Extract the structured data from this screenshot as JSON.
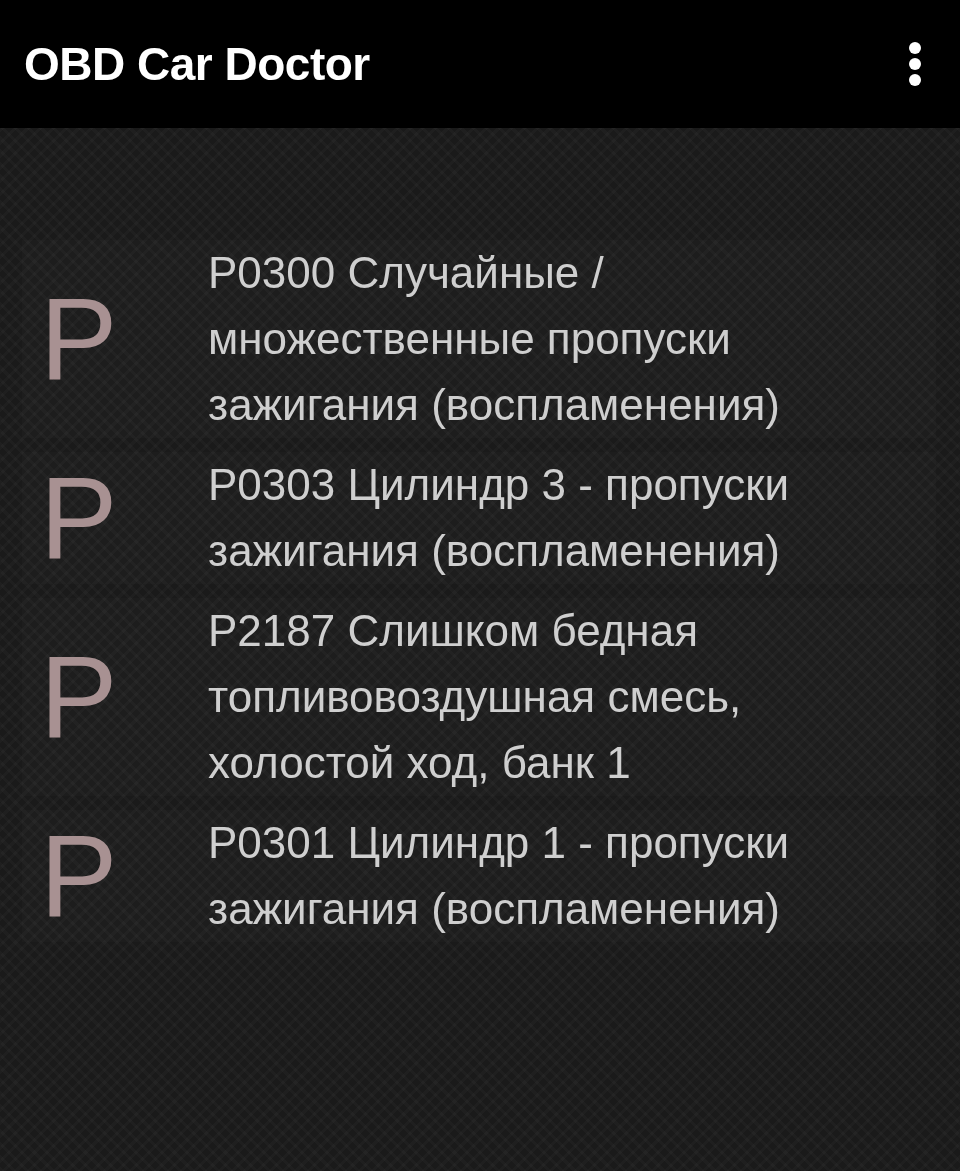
{
  "app_bar": {
    "title": "OBD Car Doctor"
  },
  "codes": [
    {
      "letter": "P",
      "code": "P0300",
      "description": "Случайные / множественные пропуски зажигания (воспламенения)"
    },
    {
      "letter": "P",
      "code": "P0303",
      "description": "Цилиндр 3 - пропуски зажигания (воспламенения)"
    },
    {
      "letter": "P",
      "code": "P2187",
      "description": "Слишком бедная топливовоздушная смесь, холостой ход, банк 1"
    },
    {
      "letter": "P",
      "code": "P0301",
      "description": "Цилиндр 1 - пропуски зажигания (воспламенения)"
    }
  ]
}
